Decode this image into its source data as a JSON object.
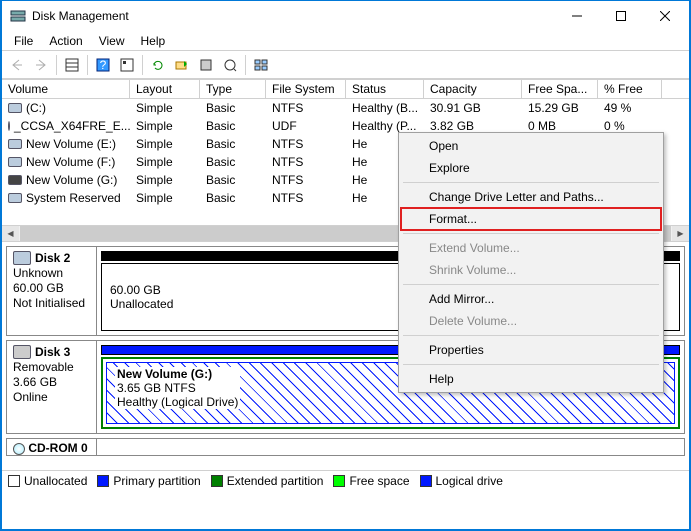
{
  "window": {
    "title": "Disk Management"
  },
  "menu": {
    "items": [
      "File",
      "Action",
      "View",
      "Help"
    ]
  },
  "columns": [
    "Volume",
    "Layout",
    "Type",
    "File System",
    "Status",
    "Capacity",
    "Free Spa...",
    "% Free"
  ],
  "volumes": [
    {
      "name": "(C:)",
      "layout": "Simple",
      "type": "Basic",
      "fs": "NTFS",
      "status": "Healthy (B...",
      "cap": "30.91 GB",
      "free": "15.29 GB",
      "pct": "49 %"
    },
    {
      "name": "_CCSA_X64FRE_E...",
      "layout": "Simple",
      "type": "Basic",
      "fs": "UDF",
      "status": "Healthy (P...",
      "cap": "3.82 GB",
      "free": "0 MB",
      "pct": "0 %"
    },
    {
      "name": "New Volume (E:)",
      "layout": "Simple",
      "type": "Basic",
      "fs": "NTFS",
      "status": "He",
      "cap": "",
      "free": "",
      "pct": ""
    },
    {
      "name": "New Volume (F:)",
      "layout": "Simple",
      "type": "Basic",
      "fs": "NTFS",
      "status": "He",
      "cap": "",
      "free": "",
      "pct": ""
    },
    {
      "name": "New Volume (G:)",
      "layout": "Simple",
      "type": "Basic",
      "fs": "NTFS",
      "status": "He",
      "cap": "",
      "free": "",
      "pct": ""
    },
    {
      "name": "System Reserved",
      "layout": "Simple",
      "type": "Basic",
      "fs": "NTFS",
      "status": "He",
      "cap": "",
      "free": "",
      "pct": ""
    }
  ],
  "disk2": {
    "title": "Disk 2",
    "l1": "Unknown",
    "l2": "60.00 GB",
    "l3": "Not Initialised",
    "body1": "60.00 GB",
    "body2": "Unallocated"
  },
  "disk3": {
    "title": "Disk 3",
    "l1": "Removable",
    "l2": "3.66 GB",
    "l3": "Online",
    "v1": "New Volume  (G:)",
    "v2": "3.65 GB NTFS",
    "v3": "Healthy (Logical Drive)"
  },
  "cdrom": {
    "title": "CD-ROM 0"
  },
  "legend": {
    "unalloc": "Unallocated",
    "primary": "Primary partition",
    "ext": "Extended partition",
    "free": "Free space",
    "logical": "Logical drive"
  },
  "context": {
    "open": "Open",
    "explore": "Explore",
    "change": "Change Drive Letter and Paths...",
    "format": "Format...",
    "extend": "Extend Volume...",
    "shrink": "Shrink Volume...",
    "mirror": "Add Mirror...",
    "delete": "Delete Volume...",
    "props": "Properties",
    "help": "Help"
  },
  "colors": {
    "black": "#000",
    "blue": "#0018ff",
    "green": "#008000",
    "lime": "#00ff00"
  }
}
